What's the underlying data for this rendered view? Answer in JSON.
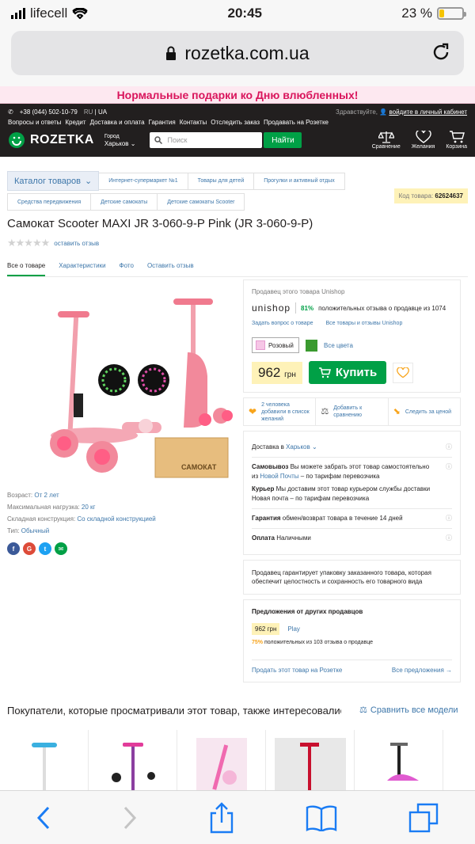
{
  "status": {
    "carrier": "lifecell",
    "time": "20:45",
    "battery_pct": "23 %",
    "battery_level": 0.23
  },
  "browser": {
    "url": "rozetka.com.ua"
  },
  "promo": {
    "text": "Нормальные подарки ко Дню влюбленных!"
  },
  "header": {
    "phone": "+38 (044) 502-10-79",
    "lang_ru": "RU",
    "lang_ua": "UA",
    "greeting": "Здравствуйте,",
    "login": "войдите в личный кабинет",
    "links": [
      "Вопросы и ответы",
      "Кредит",
      "Доставка и оплата",
      "Гарантия",
      "Контакты",
      "Отследить заказ",
      "Продавать на Розетке"
    ],
    "logo": "ROZETKA",
    "city_label": "Город",
    "city": "Харьков",
    "search_placeholder": "Поиск",
    "search_button": "Найти",
    "icons": [
      "Сравнение",
      "Желания",
      "Корзина"
    ]
  },
  "breadcrumbs": {
    "catalog": "Каталог товаров",
    "row1": [
      "Интернет-супермаркет №1",
      "Товары для детей",
      "Прогулки и активный отдых"
    ],
    "row2": [
      "Средства передвижения",
      "Детские самокаты",
      "Детские самокаты Scooter"
    ],
    "code_label": "Код товара:",
    "code": "62624637"
  },
  "product": {
    "title": "Самокат Scooter MAXI JR 3-060-9-P Pink (JR 3-060-9-P)",
    "review_link": "оставить отзыв",
    "tabs": [
      "Все о товаре",
      "Характеристики",
      "Фото",
      "Оставить отзыв"
    ],
    "box_label": "САМОКАТ",
    "specs": [
      {
        "label": "Возраст:",
        "value": "От 2 лет"
      },
      {
        "label": "Максимальная нагрузка:",
        "value": "20 кг"
      },
      {
        "label": "Складная конструкция:",
        "value": "Со складной конструкцией"
      },
      {
        "label": "Тип:",
        "value": "Обычный"
      }
    ]
  },
  "seller": {
    "label": "Продавец этого товара Unishop",
    "brand": "unishop",
    "rating_pct": "81%",
    "rating_text": "положительных отзыва о продавце из 1074",
    "ask": "Задать вопрос о товаре",
    "all": "Все товары и отзывы Unishop",
    "color_selected": "Розовый",
    "all_colors": "Все цвета",
    "price": "962",
    "currency": "грн",
    "buy": "Купить"
  },
  "actions": [
    {
      "text": "2 человека добавили в список желаний"
    },
    {
      "text": "Добавить к сравнению"
    },
    {
      "text": "Следить за ценой"
    }
  ],
  "delivery": {
    "label": "Доставка в",
    "city": "Харьков",
    "pickup_label": "Самовывоз",
    "pickup_text": "Вы можете забрать этот товар самостоятельно",
    "pickup_from": "из",
    "pickup_link": "Новой Почты",
    "pickup_tariff": "– по тарифам перевозчика",
    "courier_label": "Курьер",
    "courier_text": "Мы доставим этот товар курьером службы доставки",
    "courier_tariff": "Новая почта – по тарифам перевозчика",
    "guarantee_label": "Гарантия",
    "guarantee_text": "обмен/возврат товара в течение 14 дней",
    "payment_label": "Оплата",
    "payment_text": "Наличными"
  },
  "guarantee_note": "Продавец гарантирует упаковку заказанного товара, которая обеспечит целостность и сохранность его товарного вида",
  "offers": {
    "title": "Предложения от других продавцов",
    "price": "962 грн",
    "seller": "Play",
    "pct": "75%",
    "rating": "положительных из 103 отзыва о продавце",
    "sell_link": "Продать этот товар на Розетке",
    "all_link": "Все предложения →"
  },
  "recommend": {
    "title": "Покупатели, которые просматривали этот товар, также интересовались",
    "compare_all": "Сравнить все модели"
  }
}
